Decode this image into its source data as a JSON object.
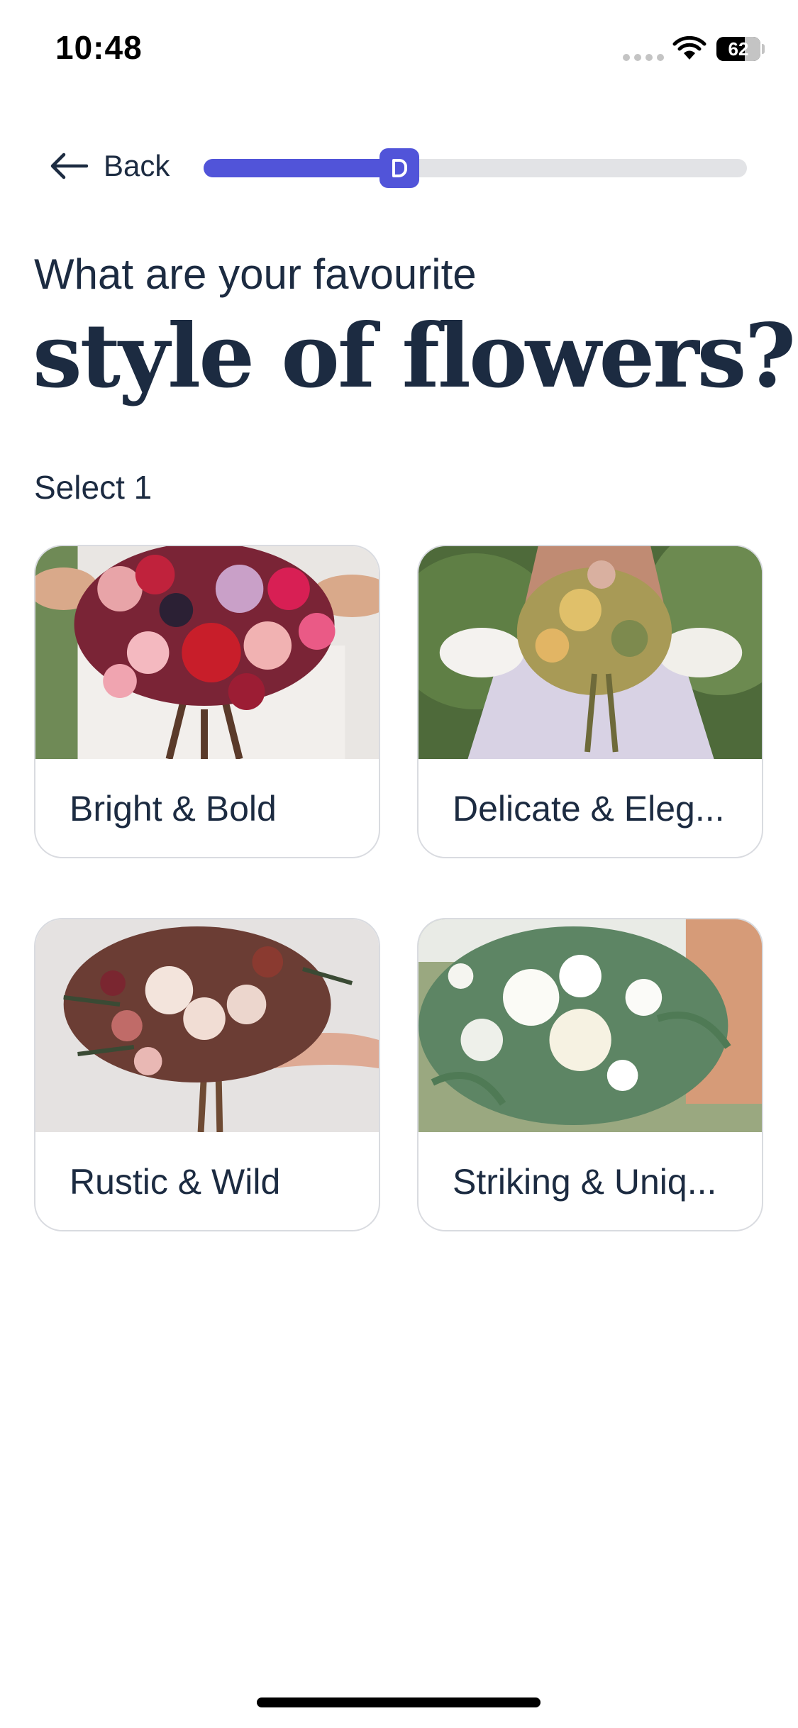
{
  "status_bar": {
    "time": "10:48",
    "battery": "62"
  },
  "nav": {
    "back_label": "Back",
    "progress": 0.36,
    "accent_color": "#5154d9",
    "thumb_icon": "heart-icon"
  },
  "question": {
    "subtitle": "What are your favourite",
    "title": "style of flowers?",
    "hint": "Select 1"
  },
  "options": [
    {
      "label": "Bright & Bold",
      "image": "red-pink-bouquet-photo"
    },
    {
      "label": "Delicate & Eleg...",
      "image": "dried-pampas-bouquet-photo"
    },
    {
      "label": "Rustic & Wild",
      "image": "burgundy-rustic-bouquet-photo"
    },
    {
      "label": "Striking & Uniq...",
      "image": "white-green-bouquet-photo"
    }
  ]
}
